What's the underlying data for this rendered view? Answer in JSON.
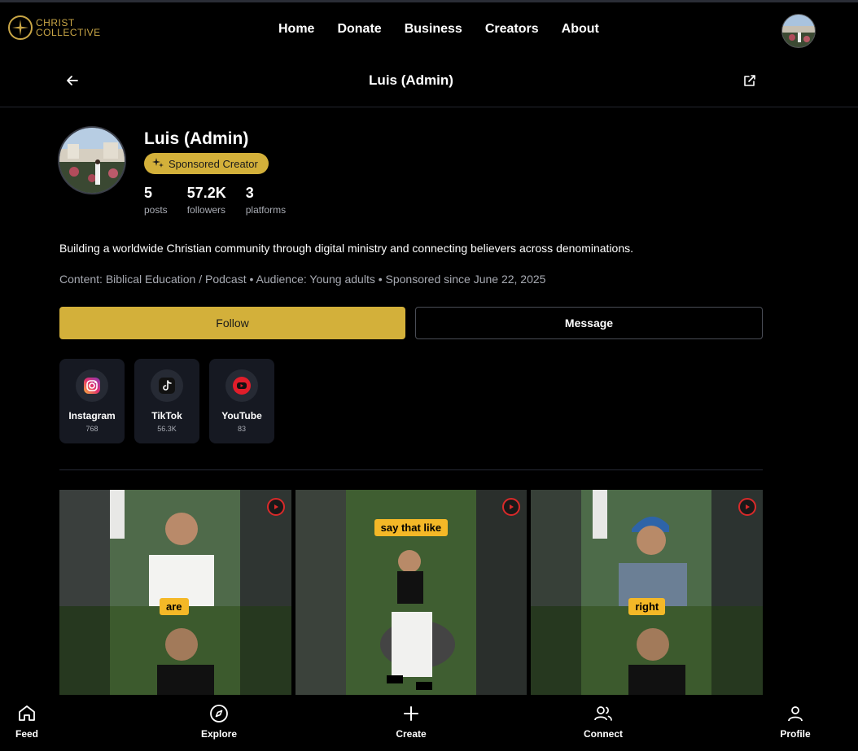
{
  "brand": {
    "line1": "CHRIST",
    "line2": "COLLECTIVE",
    "accent": "#c9a646"
  },
  "nav": {
    "links": [
      "Home",
      "Donate",
      "Business",
      "Creators",
      "About"
    ]
  },
  "subhead": {
    "title": "Luis (Admin)"
  },
  "profile": {
    "name": "Luis (Admin)",
    "badge": "Sponsored Creator",
    "stats": [
      {
        "value": "5",
        "label": "posts"
      },
      {
        "value": "57.2K",
        "label": "followers"
      },
      {
        "value": "3",
        "label": "platforms"
      }
    ],
    "bio": "Building a worldwide Christian community through digital ministry and connecting believers across denominations.",
    "meta": "Content: Biblical Education / Podcast • Audience: Young adults • Sponsored since June 22, 2025"
  },
  "actions": {
    "follow": "Follow",
    "message": "Message"
  },
  "platforms": [
    {
      "name": "Instagram",
      "count": "768",
      "icon": "instagram-icon"
    },
    {
      "name": "TikTok",
      "count": "56.3K",
      "icon": "tiktok-icon"
    },
    {
      "name": "YouTube",
      "count": "83",
      "icon": "youtube-icon"
    }
  ],
  "posts": [
    {
      "caption": "are",
      "icon": "youtube-icon"
    },
    {
      "caption": "say that like",
      "icon": "youtube-icon"
    },
    {
      "caption": "right",
      "icon": "youtube-icon"
    }
  ],
  "bottom_nav": [
    "Feed",
    "Explore",
    "Create",
    "Connect",
    "Profile"
  ],
  "colors": {
    "gold": "#d3b03a",
    "card": "#161922",
    "youtube_red": "#d92a2a"
  }
}
